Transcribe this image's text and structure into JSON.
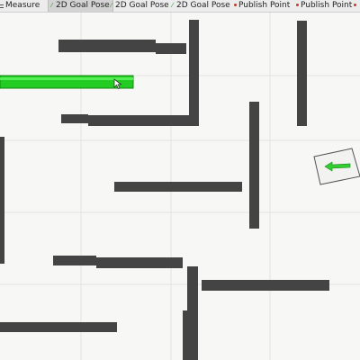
{
  "toolbar": {
    "items": [
      {
        "label": "Measure",
        "icon": "measure-icon",
        "active": false
      },
      {
        "label": "2D Goal Pose",
        "icon": "goal-arrow-icon",
        "active": true
      },
      {
        "label": "2D Goal Pose",
        "icon": "goal-arrow-icon",
        "active": false
      },
      {
        "label": "2D Goal Pose",
        "icon": "goal-arrow-icon",
        "active": false
      },
      {
        "label": "Publish Point",
        "icon": "pin-icon",
        "active": false
      },
      {
        "label": "Publish Point",
        "icon": "pin-icon",
        "active": false
      }
    ]
  },
  "colors": {
    "wall": "#444444",
    "path": "#22cc22",
    "goal_arrow": "#33cc33",
    "background": "#f7f7f5",
    "pin": "#c0392b"
  }
}
